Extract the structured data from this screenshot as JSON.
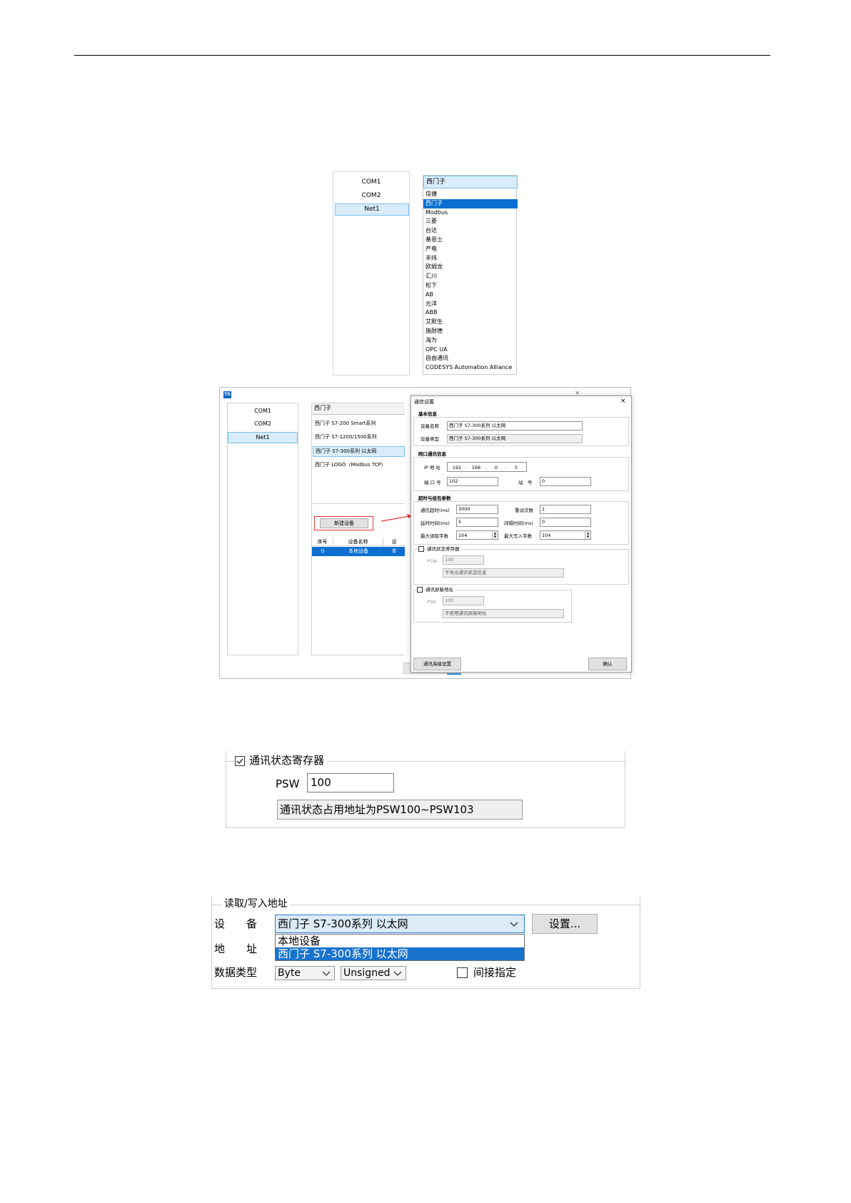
{
  "fig1": {
    "ports": [
      "COM1",
      "COM2",
      "Net1"
    ],
    "selected_port": "Net1",
    "combo_value": "西门子",
    "options": [
      "信捷",
      "西门子",
      "Modbus",
      "三菱",
      "台达",
      "基恩士",
      "产电",
      "丰炜",
      "欧姆龙",
      "汇川",
      "松下",
      "AB",
      "光洋",
      "ABB",
      "艾默生",
      "施耐德",
      "海为",
      "OPC UA",
      "自由通讯",
      "CODESYS Automation Alliance"
    ],
    "highlighted_option": "西门子"
  },
  "fig2": {
    "app_icon": "TS",
    "ports": [
      "COM1",
      "COM2",
      "Net1"
    ],
    "combo_value": "西门子",
    "devices": [
      "西门子 S7-200 Smart系列",
      "西门子 S7-1200/1500系列",
      "西门子 S7-300系列 以太网",
      "西门子 LOGO（Modbus TCP）"
    ],
    "new_device_button": "新建设备",
    "table_headers": [
      "序号",
      "设备名称",
      "设"
    ],
    "table_rows": [
      [
        "0",
        "本地设备",
        "本"
      ]
    ],
    "dialog": {
      "title": "通信设置",
      "close": "×",
      "basic_title": "基本信息",
      "device_name_label": "设备名称",
      "device_name_value": "西门子 S7-300系列 以太网",
      "device_type_label": "设备类型",
      "device_type_value": "西门子 S7-300系列 以太网",
      "net_title": "网口通讯信息",
      "ip_label": "IP 地 址",
      "ip": [
        "192",
        "168",
        "0",
        "5"
      ],
      "port_label": "端 口 号",
      "port_value": "102",
      "station_label": "站　号",
      "station_value": "0",
      "timeout_title": "超时与组包参数",
      "comm_timeout_label": "通信超时(ms)",
      "comm_timeout_value": "3000",
      "retry_label": "重试次数",
      "retry_value": "1",
      "delay_label": "延时时间(ms)",
      "delay_value": "5",
      "interval_label": "间隔时间(ms)",
      "interval_value": "0",
      "max_read_label": "最大读取字数",
      "max_read_value": "104",
      "max_write_label": "最大写入字数",
      "max_write_value": "104",
      "status_reg_label": "通讯状态寄存器",
      "psw_label": "PSW",
      "psw_value": "100",
      "psw_desc": "不导出通讯状态信息",
      "shield_label": "通讯屏蔽地址",
      "psb_label": "PSB",
      "psb_value": "100",
      "psb_desc": "不使用通讯屏蔽地址",
      "advanced_button": "通讯高级设置",
      "ok_button": "确认"
    }
  },
  "fig3": {
    "group_label": "通讯状态寄存器",
    "checked": true,
    "psw_label": "PSW",
    "psw_value": "100",
    "desc": "通讯状态占用地址为PSW100~PSW103"
  },
  "fig4": {
    "group_label": "读取/写入地址",
    "device_label": "设　　备",
    "device_value": "西门子 S7-300系列 以太网",
    "settings_button": "设置...",
    "address_label": "地　　址",
    "dropdown_items": [
      "本地设备",
      "西门子 S7-300系列 以太网"
    ],
    "datatype_label": "数据类型",
    "datatype_value": "Byte",
    "sign_value": "Unsigned",
    "indirect_label": "间接指定",
    "indirect_checked": false
  }
}
